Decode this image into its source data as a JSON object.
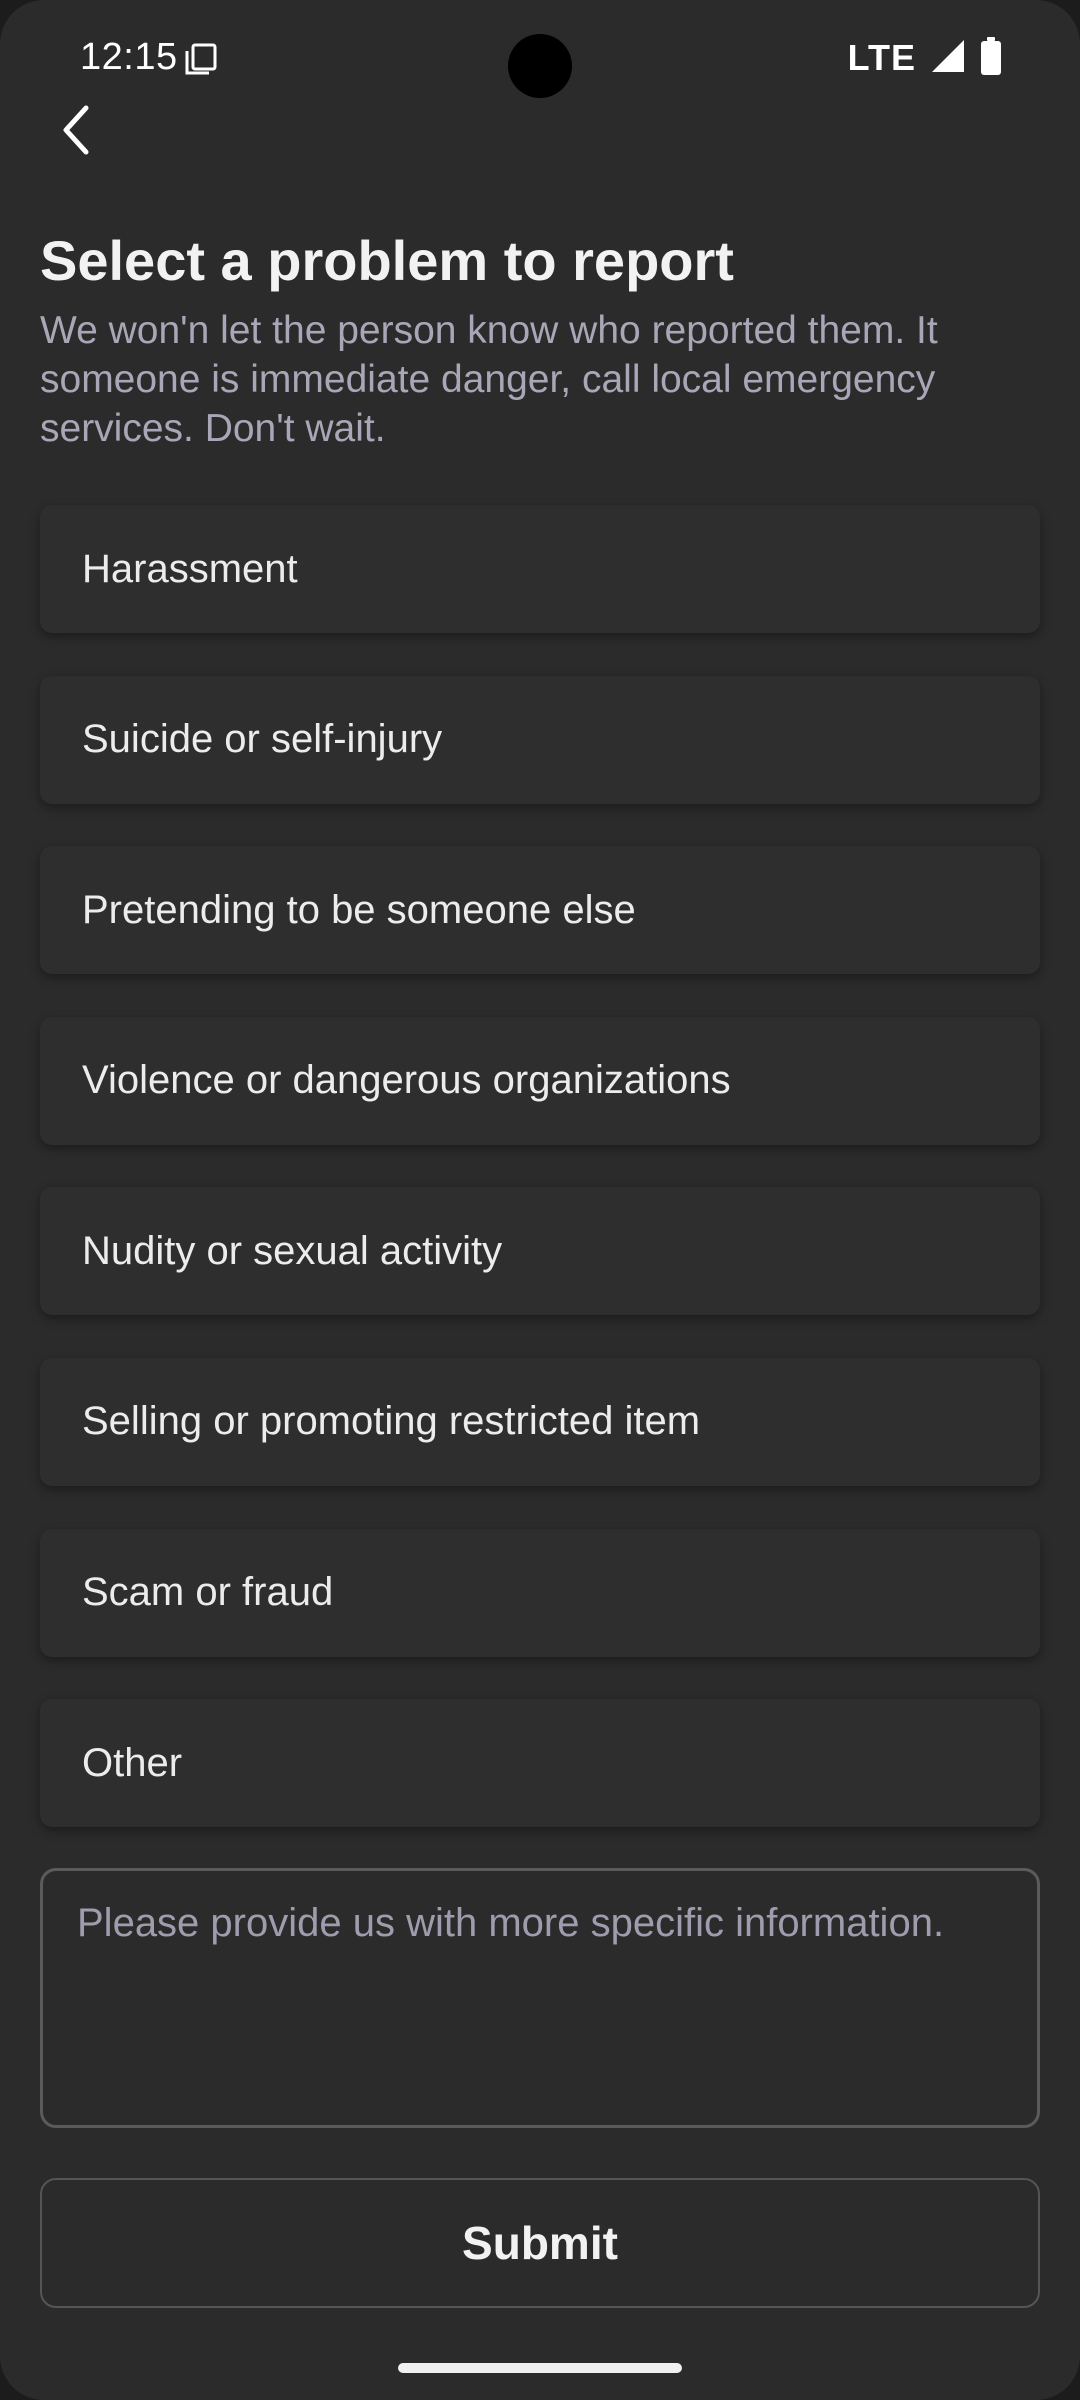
{
  "status_bar": {
    "time": "12:15",
    "network": "LTE",
    "icons": [
      "screenshot-icon",
      "signal-icon",
      "battery-icon"
    ]
  },
  "header": {
    "back_icon": "chevron-left-icon",
    "title": "Select a problem to report",
    "subtitle": "We won'n let the person know who reported them. It someone is immediate danger, call local emergency services. Don't wait."
  },
  "options": [
    {
      "label": "Harassment"
    },
    {
      "label": "Suicide or self-injury"
    },
    {
      "label": "Pretending to be someone else"
    },
    {
      "label": "Violence or dangerous organizations"
    },
    {
      "label": "Nudity or sexual activity"
    },
    {
      "label": "Selling or promoting restricted item"
    },
    {
      "label": "Scam or fraud"
    },
    {
      "label": "Other"
    }
  ],
  "details": {
    "value": "",
    "placeholder": "Please provide us with more specific information."
  },
  "submit": {
    "label": "Submit"
  },
  "colors": {
    "background": "#2b2b2b",
    "option_background": "#2e2e2e",
    "subtitle_text": "#a9a6b7",
    "primary_text": "#f2f2f2"
  }
}
